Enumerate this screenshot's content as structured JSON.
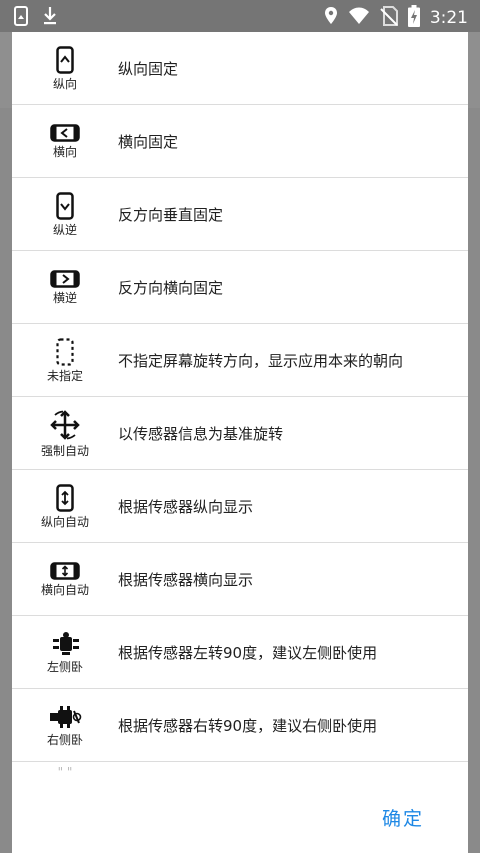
{
  "statusbar": {
    "time": "3:21",
    "icons": [
      "screenshot-icon",
      "download-icon",
      "location-icon",
      "wifi-icon",
      "no-sim-icon",
      "battery-charging-icon"
    ]
  },
  "options": [
    {
      "icon": "portrait-lock-icon",
      "label": "纵向",
      "desc": "纵向固定"
    },
    {
      "icon": "landscape-lock-icon",
      "label": "横向",
      "desc": "横向固定"
    },
    {
      "icon": "reverse-portrait-icon",
      "label": "纵逆",
      "desc": "反方向垂直固定"
    },
    {
      "icon": "reverse-landscape-icon",
      "label": "横逆",
      "desc": "反方向横向固定"
    },
    {
      "icon": "unspecified-icon",
      "label": "未指定",
      "desc": "不指定屏幕旋转方向，显示应用本来的朝向"
    },
    {
      "icon": "force-auto-rotate-icon",
      "label": "强制自动",
      "desc": "以传感器信息为基准旋转"
    },
    {
      "icon": "portrait-auto-icon",
      "label": "纵向自动",
      "desc": "根据传感器纵向显示"
    },
    {
      "icon": "landscape-auto-icon",
      "label": "横向自动",
      "desc": "根据传感器横向显示"
    },
    {
      "icon": "lie-left-icon",
      "label": "左侧卧",
      "desc": "根据传感器左转90度，建议左侧卧使用"
    },
    {
      "icon": "lie-right-icon",
      "label": "右侧卧",
      "desc": "根据传感器右转90度，建议右侧卧使用"
    }
  ],
  "partial_label": "\" \"",
  "dialog": {
    "confirm_label": "确定",
    "accent_color": "#1e88e5"
  }
}
